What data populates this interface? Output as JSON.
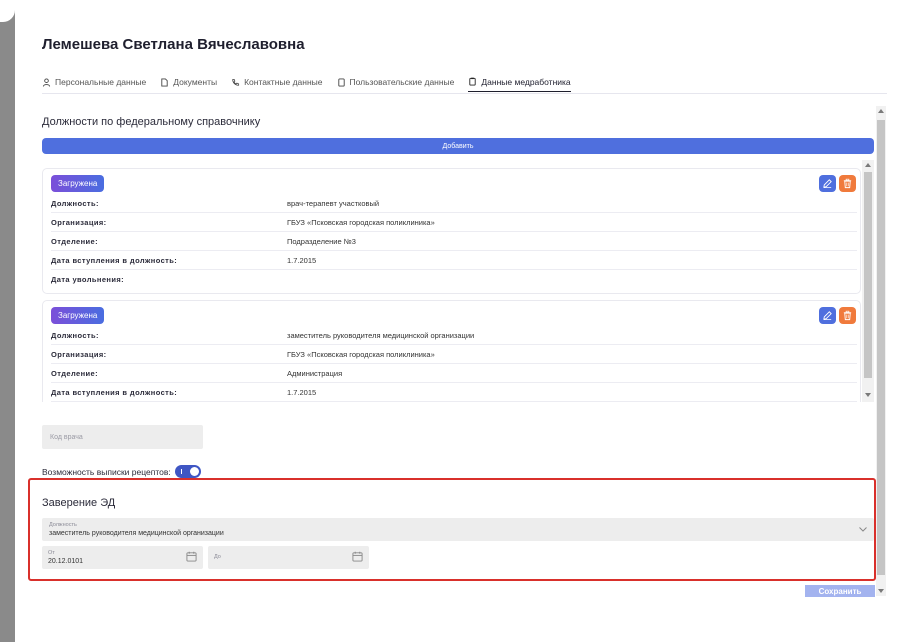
{
  "employee": {
    "name": "Лемешева Светлана Вячеславовна"
  },
  "tabs": [
    {
      "label": "Персональные данные",
      "icon": "person-icon"
    },
    {
      "label": "Документы",
      "icon": "document-icon"
    },
    {
      "label": "Контактные данные",
      "icon": "phone-icon"
    },
    {
      "label": "Пользовательские данные",
      "icon": "user-data-icon"
    },
    {
      "label": "Данные медработника",
      "icon": "clipboard-icon",
      "active": true
    }
  ],
  "positions_section": {
    "title": "Должности по федеральному справочнику",
    "add_label": "Добавить",
    "cards": [
      {
        "badge": "Загружена",
        "rows": [
          {
            "label": "Должность:",
            "value": "врач-терапевт участковый"
          },
          {
            "label": "Организация:",
            "value": "ГБУЗ «Псковская городская поликлиника»"
          },
          {
            "label": "Отделение:",
            "value": "Подразделение №3"
          },
          {
            "label": "Дата вступления в должность:",
            "value": "1.7.2015"
          },
          {
            "label": "Дата увольнения:",
            "value": ""
          }
        ]
      },
      {
        "badge": "Загружена",
        "rows": [
          {
            "label": "Должность:",
            "value": "заместитель руководителя медицинской организации"
          },
          {
            "label": "Организация:",
            "value": "ГБУЗ «Псковская городская поликлиника»"
          },
          {
            "label": "Отделение:",
            "value": "Администрация"
          },
          {
            "label": "Дата вступления в должность:",
            "value": "1.7.2015"
          }
        ]
      }
    ]
  },
  "doctor_code": {
    "placeholder": "Код врача",
    "value": ""
  },
  "recipe": {
    "label": "Возможность выписки рецептов:",
    "enabled": true
  },
  "ed_certification": {
    "title": "Заверение ЭД",
    "position_field": {
      "label": "Должность",
      "value": "заместитель руководителя медицинской организации"
    },
    "from_field": {
      "label": "От",
      "value": "20.12.0101"
    },
    "to_field": {
      "label": "До",
      "value": ""
    }
  },
  "save_label": "Сохранить",
  "colors": {
    "primary": "#4f6fde",
    "delete": "#f07a3c",
    "highlight": "#d9302b",
    "toggle": "#3f56c4"
  }
}
